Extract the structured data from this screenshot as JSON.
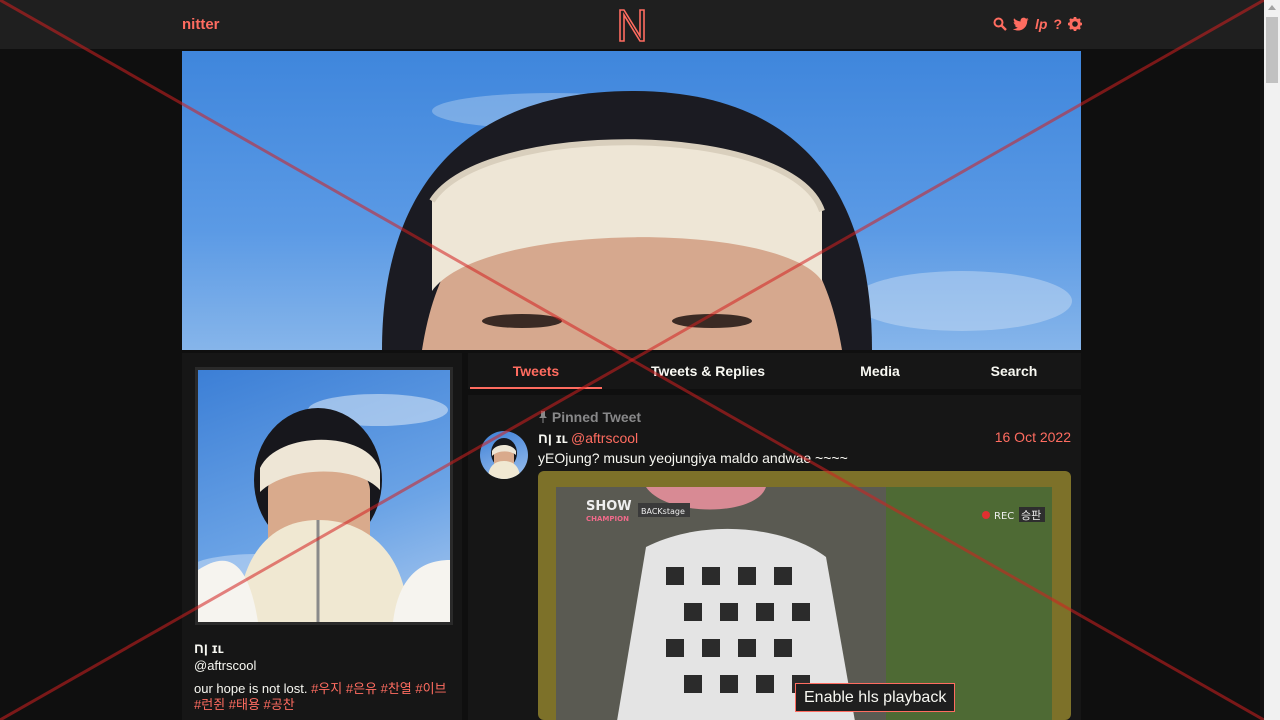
{
  "nav": {
    "brand": "nitter",
    "icons": [
      "search-icon",
      "twitter-icon",
      "lp-icon",
      "help-icon",
      "gear-icon"
    ],
    "lp_label": "lp",
    "help_label": "?"
  },
  "colors": {
    "accent": "#ff6c60",
    "background": "#0f0f0f",
    "panel": "#161616",
    "text": "#f8f8f2"
  },
  "profile": {
    "name": "ןח ɪʟ",
    "handle": "@aftrscool",
    "bio_text": "our hope is not lost. ",
    "bio_tags": "#우지 #은유 #찬열 #이브 #런쥔 #태용 #공찬"
  },
  "tabs": [
    {
      "label": "Tweets",
      "active": true
    },
    {
      "label": "Tweets & Replies",
      "active": false
    },
    {
      "label": "Media",
      "active": false
    },
    {
      "label": "Search",
      "active": false
    }
  ],
  "tweet": {
    "pinned_label": "Pinned Tweet",
    "name": "ןח ɪʟ",
    "handle": "@aftrscool",
    "date": "16 Oct 2022",
    "text": "yEOjung? musun yeojungiya maldo andwae ~~~~",
    "media_button": "Enable hls playback",
    "video_labels": {
      "show": "SHOW",
      "champion": "CHAMPION",
      "backstage": "BACKstage",
      "rec": "REC",
      "win": "승판"
    }
  }
}
